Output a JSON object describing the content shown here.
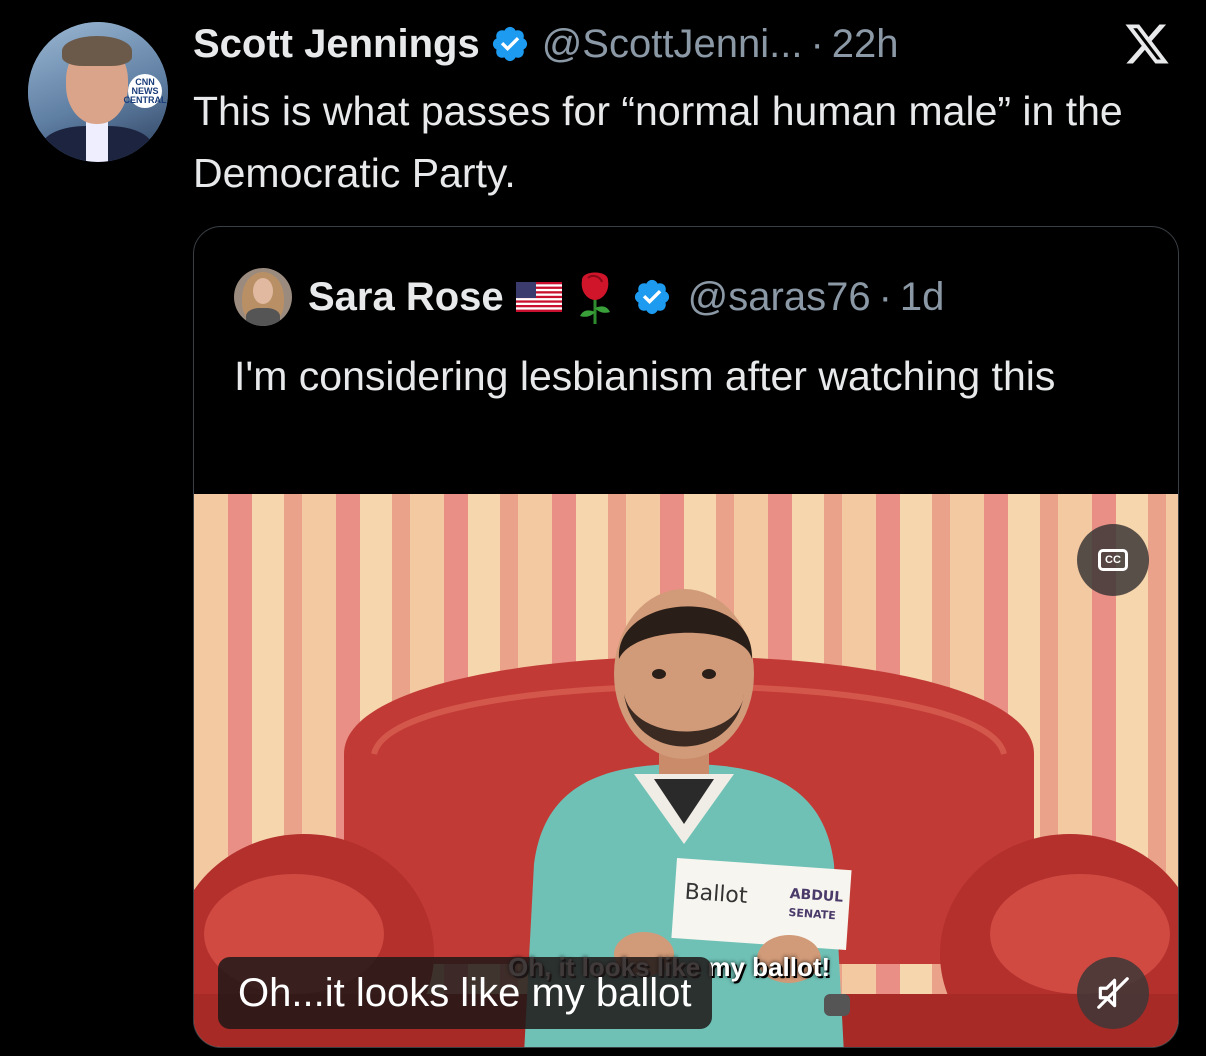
{
  "tweet": {
    "author_name": "Scott Jennings",
    "handle": "@ScottJenni...",
    "time": "22h",
    "separator": "·",
    "text": "This is what passes for “normal human male” in the Democratic Party.",
    "avatar_logo_text": "CNN NEWS CENTRAL"
  },
  "quoted": {
    "author_name": "Sara Rose",
    "handle": "@saras76",
    "time": "1d",
    "separator": "·",
    "text": "I'm considering lesbianism after watching this",
    "flag_icon": "us-flag",
    "rose_icon": "rose"
  },
  "media": {
    "cc_label": "CC",
    "burned_in_caption": "Oh, it looks like my ballot!",
    "caption_text": "Oh...it looks like my ballot",
    "card_handwriting": "Ballot",
    "card_brand": "ABDUL",
    "card_sub": "SENATE"
  },
  "colors": {
    "background": "#000000",
    "text": "#e7e9ea",
    "secondary": "#8b98a5",
    "verified": "#1d9bf0",
    "border": "#3a3f44"
  }
}
